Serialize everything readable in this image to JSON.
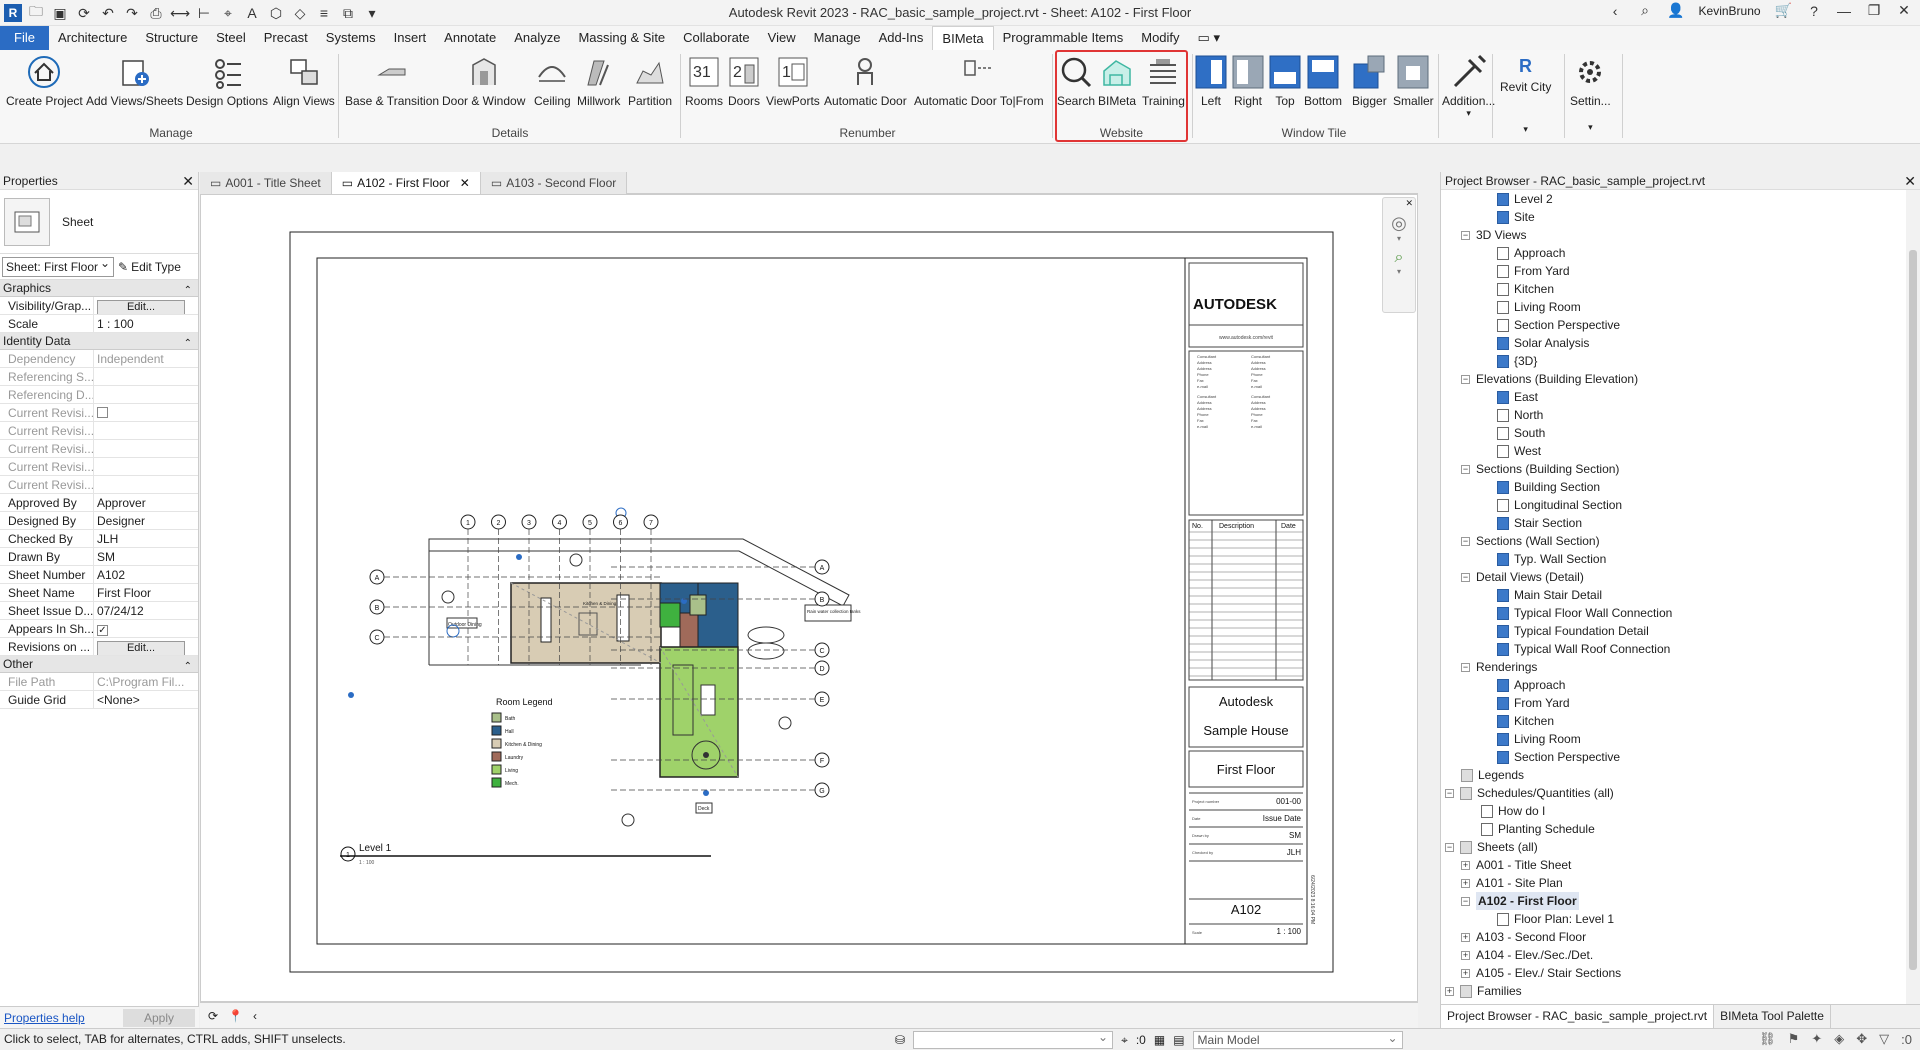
{
  "window": {
    "title": "Autodesk Revit 2023 - RAC_basic_sample_project.rvt - Sheet: A102 - First Floor",
    "user": "KevinBruno"
  },
  "menu": {
    "tabs": [
      "File",
      "Architecture",
      "Structure",
      "Steel",
      "Precast",
      "Systems",
      "Insert",
      "Annotate",
      "Analyze",
      "Massing & Site",
      "Collaborate",
      "View",
      "Manage",
      "Add-Ins",
      "BIMeta",
      "Programmable Items",
      "Modify"
    ],
    "active": "BIMeta"
  },
  "ribbon": {
    "manage": {
      "create_project": "Create Project",
      "add_views": "Add Views/Sheets",
      "design_options": "Design Options",
      "align_views": "Align Views",
      "panel": "Manage"
    },
    "details": {
      "base_transition": "Base & Transition",
      "door_window": "Door & Window",
      "ceiling": "Ceiling",
      "millwork": "Millwork",
      "partition": "Partition",
      "panel": "Details"
    },
    "renumber": {
      "rooms": "Rooms",
      "doors": "Doors",
      "viewports": "ViewPorts",
      "auto_door": "Automatic Door",
      "auto_door_tofrom": "Automatic Door To|From",
      "panel": "Renumber"
    },
    "website": {
      "search": "Search",
      "bimeta": "BIMeta",
      "training": "Training",
      "panel": "Website"
    },
    "window_tile": {
      "left": "Left",
      "right": "Right",
      "top": "Top",
      "bottom": "Bottom",
      "bigger": "Bigger",
      "smaller": "Smaller",
      "panel": "Window Tile"
    },
    "extra": {
      "additional": "Addition...",
      "revit_city": "Revit City",
      "settings": "Settin..."
    }
  },
  "properties": {
    "title": "Properties",
    "type_name": "Sheet",
    "type_selector": "Sheet: First Floor",
    "edit_type": "Edit Type",
    "groups": {
      "graphics": "Graphics",
      "identity": "Identity Data",
      "other": "Other"
    },
    "graphics_rows": [
      {
        "k": "Visibility/Grap...",
        "v": "Edit..."
      },
      {
        "k": "Scale",
        "v": "1 : 100"
      }
    ],
    "identity_rows": [
      {
        "k": "Dependency",
        "v": "Independent"
      },
      {
        "k": "Referencing S...",
        "v": ""
      },
      {
        "k": "Referencing D...",
        "v": ""
      },
      {
        "k": "Current Revisi...",
        "v": ""
      },
      {
        "k": "Current Revisi...",
        "v": ""
      },
      {
        "k": "Current Revisi...",
        "v": ""
      },
      {
        "k": "Current Revisi...",
        "v": ""
      },
      {
        "k": "Current Revisi...",
        "v": ""
      },
      {
        "k": "Approved By",
        "v": "Approver"
      },
      {
        "k": "Designed By",
        "v": "Designer"
      },
      {
        "k": "Checked By",
        "v": "JLH"
      },
      {
        "k": "Drawn By",
        "v": "SM"
      },
      {
        "k": "Sheet Number",
        "v": "A102"
      },
      {
        "k": "Sheet Name",
        "v": "First Floor"
      },
      {
        "k": "Sheet Issue D...",
        "v": "07/24/12"
      },
      {
        "k": "Appears In Sh...",
        "v": "✓"
      },
      {
        "k": "Revisions on ...",
        "v": "Edit..."
      }
    ],
    "other_rows": [
      {
        "k": "File Path",
        "v": "C:\\Program Fil..."
      },
      {
        "k": "Guide Grid",
        "v": "<None>"
      }
    ],
    "help": "Properties help",
    "apply": "Apply"
  },
  "view_tabs": [
    {
      "label": "A001 - Title Sheet"
    },
    {
      "label": "A102 - First Floor"
    },
    {
      "label": "A103 - Second Floor"
    }
  ],
  "sheet": {
    "brand": "AUTODESK",
    "website": "www.autodesk.com/revit",
    "consult": [
      "Consultant",
      "Address",
      "Address",
      "Phone",
      "Fax",
      "e-mail"
    ],
    "rev_head": {
      "no": "No.",
      "desc": "Description",
      "date": "Date"
    },
    "owner": "Autodesk",
    "project": "Sample House",
    "sheet_name": "First Floor",
    "fields": [
      {
        "k": "Project number",
        "v": "001-00"
      },
      {
        "k": "Date",
        "v": "Issue Date"
      },
      {
        "k": "Drawn by",
        "v": "SM"
      },
      {
        "k": "Checked by",
        "v": "JLH"
      }
    ],
    "number": "A102",
    "scale_k": "Scale",
    "scale_v": "1 : 100",
    "stamp": "6/24/2023 8:16:04 PM",
    "view_title": "Level 1",
    "view_scale": "1 : 100",
    "view_num": "1",
    "legend_title": "Room Legend",
    "legend": [
      {
        "label": "Bath",
        "color": "#a9c08a"
      },
      {
        "label": "Hall",
        "color": "#2b5f8c"
      },
      {
        "label": "Kitchen & Dining",
        "color": "#d8ccb4"
      },
      {
        "label": "Laundry",
        "color": "#a06a5a"
      },
      {
        "label": "Living",
        "color": "#9fd26a"
      },
      {
        "label": "Mech.",
        "color": "#3fb13f"
      }
    ],
    "grids_top": [
      "1",
      "2",
      "3",
      "4",
      "5",
      "6",
      "7"
    ],
    "grids_left": [
      "A",
      "B",
      "C"
    ],
    "grids_right": [
      "A",
      "B",
      "C",
      "D",
      "E",
      "F",
      "G"
    ],
    "tags": {
      "outdoor": "Outdoor Dining",
      "kitchen": "Kitchen & Dining",
      "water": "Rain water collection tanks",
      "deck": "Deck"
    }
  },
  "browser": {
    "title": "Project Browser - RAC_basic_sample_project.rvt",
    "items": [
      {
        "t": "Level 2",
        "d": 3,
        "i": "b"
      },
      {
        "t": "Site",
        "d": 3,
        "i": "b"
      },
      {
        "t": "3D Views",
        "d": 1,
        "e": "-"
      },
      {
        "t": "Approach",
        "d": 3,
        "i": "w"
      },
      {
        "t": "From Yard",
        "d": 3,
        "i": "w"
      },
      {
        "t": "Kitchen",
        "d": 3,
        "i": "w"
      },
      {
        "t": "Living Room",
        "d": 3,
        "i": "w"
      },
      {
        "t": "Section Perspective",
        "d": 3,
        "i": "w"
      },
      {
        "t": "Solar Analysis",
        "d": 3,
        "i": "b"
      },
      {
        "t": "{3D}",
        "d": 3,
        "i": "b"
      },
      {
        "t": "Elevations (Building Elevation)",
        "d": 1,
        "e": "-"
      },
      {
        "t": "East",
        "d": 3,
        "i": "b"
      },
      {
        "t": "North",
        "d": 3,
        "i": "w"
      },
      {
        "t": "South",
        "d": 3,
        "i": "w"
      },
      {
        "t": "West",
        "d": 3,
        "i": "w"
      },
      {
        "t": "Sections (Building Section)",
        "d": 1,
        "e": "-"
      },
      {
        "t": "Building Section",
        "d": 3,
        "i": "b"
      },
      {
        "t": "Longitudinal Section",
        "d": 3,
        "i": "w"
      },
      {
        "t": "Stair Section",
        "d": 3,
        "i": "b"
      },
      {
        "t": "Sections (Wall Section)",
        "d": 1,
        "e": "-"
      },
      {
        "t": "Typ. Wall Section",
        "d": 3,
        "i": "b"
      },
      {
        "t": "Detail Views (Detail)",
        "d": 1,
        "e": "-"
      },
      {
        "t": "Main Stair Detail",
        "d": 3,
        "i": "b"
      },
      {
        "t": "Typical Floor Wall Connection",
        "d": 3,
        "i": "b"
      },
      {
        "t": "Typical Foundation Detail",
        "d": 3,
        "i": "b"
      },
      {
        "t": "Typical Wall Roof Connection",
        "d": 3,
        "i": "b"
      },
      {
        "t": "Renderings",
        "d": 1,
        "e": "-"
      },
      {
        "t": "Approach",
        "d": 3,
        "i": "b"
      },
      {
        "t": "From Yard",
        "d": 3,
        "i": "b"
      },
      {
        "t": "Kitchen",
        "d": 3,
        "i": "b"
      },
      {
        "t": "Living Room",
        "d": 3,
        "i": "b"
      },
      {
        "t": "Section Perspective",
        "d": 3,
        "i": "b"
      },
      {
        "t": "Legends",
        "d": 0,
        "i": "g"
      },
      {
        "t": "Schedules/Quantities (all)",
        "d": 0,
        "e": "-",
        "i": "g"
      },
      {
        "t": "How do I",
        "d": 2,
        "i": "w"
      },
      {
        "t": "Planting Schedule",
        "d": 2,
        "i": "w"
      },
      {
        "t": "Sheets (all)",
        "d": 0,
        "e": "-",
        "i": "g"
      },
      {
        "t": "A001 - Title Sheet",
        "d": 1,
        "e": "+"
      },
      {
        "t": "A101 - Site Plan",
        "d": 1,
        "e": "+"
      },
      {
        "t": "A102 - First Floor",
        "d": 1,
        "e": "-",
        "sel": true
      },
      {
        "t": "Floor Plan: Level 1",
        "d": 3,
        "i": "w"
      },
      {
        "t": "A103 - Second Floor",
        "d": 1,
        "e": "+"
      },
      {
        "t": "A104 - Elev./Sec./Det.",
        "d": 1,
        "e": "+"
      },
      {
        "t": "A105 - Elev./ Stair Sections",
        "d": 1,
        "e": "+"
      },
      {
        "t": "Families",
        "d": 0,
        "e": "+",
        "i": "g"
      }
    ],
    "tabs": [
      "Project Browser - RAC_basic_sample_project.rvt",
      "BIMeta Tool Palette"
    ]
  },
  "status": {
    "message": "Click to select, TAB for alternates, CTRL adds, SHIFT unselects.",
    "workset": ":0",
    "model": "Main Model",
    "filter": ":0"
  }
}
